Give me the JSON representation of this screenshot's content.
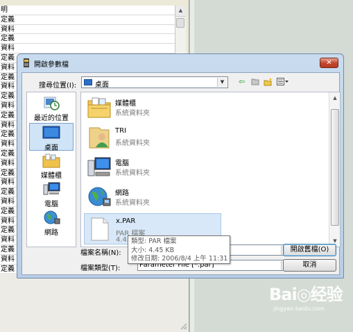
{
  "background_list": {
    "rows": [
      "明",
      "定義",
      "資料",
      "定義",
      "資料",
      "定義",
      "資料",
      "定義",
      "資料",
      "定義",
      "資料",
      "定義",
      "資料",
      "定義",
      "資料",
      "定義",
      "資料",
      "定義",
      "資料",
      "定義",
      "資料",
      "定義",
      "資料",
      "定義",
      "資料",
      "定義",
      "資料",
      "定義"
    ]
  },
  "dialog": {
    "title": "開啟參數檔",
    "close_label": "✕",
    "look_in": {
      "label": "搜尋位置(I):",
      "value": "桌面"
    },
    "places": [
      {
        "name": "recent",
        "label": "最近的位置"
      },
      {
        "name": "desktop",
        "label": "桌面"
      },
      {
        "name": "libraries",
        "label": "媒體櫃"
      },
      {
        "name": "computer",
        "label": "電腦"
      },
      {
        "name": "network",
        "label": "網路"
      }
    ],
    "files": [
      {
        "name": "媒體櫃",
        "type": "系統資料夾",
        "icon": "libraries-folder-icon"
      },
      {
        "name": "TRI",
        "type": "系統資料夾",
        "icon": "user-folder-icon"
      },
      {
        "name": "電腦",
        "type": "系統資料夾",
        "icon": "computer-icon"
      },
      {
        "name": "網路",
        "type": "系統資料夾",
        "icon": "network-globe-icon"
      },
      {
        "name": "x.PAR",
        "type": "PAR 檔案",
        "size": "4.45 KB",
        "icon": "document-icon"
      }
    ],
    "filename": {
      "label": "檔案名稱(N):",
      "value": ""
    },
    "filetype": {
      "label": "檔案類型(T):",
      "value": "Parameter File [*.par]"
    },
    "open_button": "開啟舊檔(O)",
    "cancel_button": "取消",
    "tooltip": {
      "type": "類型: PAR 檔案",
      "size": "大小: 4.45 KB",
      "modified": "修改日期: 2006/8/4 上午 11:31"
    }
  },
  "watermark": {
    "text": "Bai◎经验",
    "url": "jingyan.baidu.com"
  }
}
